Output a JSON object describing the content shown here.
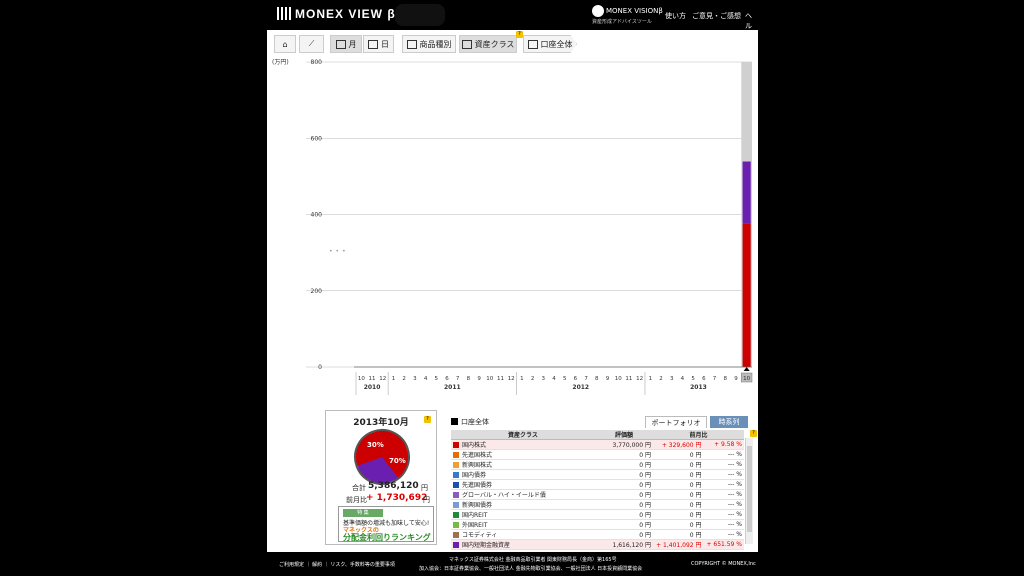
{
  "header": {
    "logo_text": "MONEX VIEW β",
    "vision_title": "MONEX VISIONβ",
    "vision_sub": "資産形成アドバイスツール",
    "links": [
      "使い方",
      "ご意見・ご感想",
      "ヘル"
    ]
  },
  "toolbar": {
    "month_label": "月",
    "day_label": "日",
    "product_label": "商品種別",
    "asset_class_label": "資産クラス",
    "account_label": "口座全体",
    "help_mark": "?"
  },
  "chart_data": {
    "type": "bar",
    "unit_label": "(万円)",
    "ylim": [
      0,
      800
    ],
    "yticks": [
      "0",
      "200",
      "400",
      "600",
      "800"
    ],
    "months": [
      "10",
      "11",
      "12",
      "1",
      "2",
      "3",
      "4",
      "5",
      "6",
      "7",
      "8",
      "9",
      "10",
      "11",
      "12",
      "1",
      "2",
      "3",
      "4",
      "5",
      "6",
      "7",
      "8",
      "9",
      "10",
      "11",
      "12",
      "1",
      "2",
      "3",
      "4",
      "5",
      "6",
      "7",
      "8",
      "9",
      "10"
    ],
    "year_labels": [
      {
        "label": "2010",
        "start": 0,
        "end": 2
      },
      {
        "label": "2011",
        "start": 3,
        "end": 14
      },
      {
        "label": "2012",
        "start": 15,
        "end": 26
      },
      {
        "label": "2013",
        "start": 27,
        "end": 36
      }
    ],
    "series": [
      {
        "name": "国内株式",
        "color": "#cc0000",
        "values": [
          0,
          0,
          0,
          0,
          0,
          0,
          0,
          0,
          0,
          0,
          0,
          0,
          0,
          0,
          0,
          0,
          0,
          0,
          0,
          0,
          0,
          0,
          0,
          0,
          0,
          0,
          0,
          0,
          0,
          0,
          0,
          0,
          0,
          0,
          0,
          0,
          377
        ]
      },
      {
        "name": "国内短期金融資産",
        "color": "#6a1fb0",
        "values": [
          0,
          0,
          0,
          0,
          0,
          0,
          0,
          0,
          0,
          0,
          0,
          0,
          0,
          0,
          0,
          0,
          0,
          0,
          0,
          0,
          0,
          0,
          0,
          0,
          0,
          0,
          0,
          0,
          0,
          0,
          0,
          0,
          0,
          0,
          0,
          0,
          162
        ]
      }
    ],
    "selected_index": 36
  },
  "portfolio": {
    "date_label": "2013年10月",
    "pie_pct_1": "30%",
    "pie_pct_2": "70%",
    "total_label": "合計",
    "total_value": "5,386,120",
    "yen": "円",
    "prev_label": "前月比",
    "prev_value": "+ 1,730,692",
    "promo_tag": "特 集",
    "promo_line1": "基準価額の増減も加味して安心!",
    "promo_line2": "マネックスの",
    "promo_line3": "分配金利回りランキング",
    "account_scope": "口座全体",
    "tab_portfolio": "ポートフォリオ",
    "tab_timeseries": "時系列",
    "columns": [
      "資産クラス",
      "評価額",
      "前月比"
    ],
    "rows": [
      {
        "color": "#cc0000",
        "name": "国内株式",
        "value": "3,770,000",
        "yen": "円",
        "chg": "+ 329,600",
        "chg_yen": "円",
        "pct": "+ 9.58",
        "pctsign": "%"
      },
      {
        "color": "#e46c0a",
        "name": "先進国株式",
        "value": "0",
        "yen": "円",
        "chg": "0",
        "chg_yen": "円",
        "pct": "---",
        "pctsign": "%"
      },
      {
        "color": "#f0a030",
        "name": "新興国株式",
        "value": "0",
        "yen": "円",
        "chg": "0",
        "chg_yen": "円",
        "pct": "---",
        "pctsign": "%"
      },
      {
        "color": "#3a78c8",
        "name": "国内債券",
        "value": "0",
        "yen": "円",
        "chg": "0",
        "chg_yen": "円",
        "pct": "---",
        "pctsign": "%"
      },
      {
        "color": "#1a4fb0",
        "name": "先進国債券",
        "value": "0",
        "yen": "円",
        "chg": "0",
        "chg_yen": "円",
        "pct": "---",
        "pctsign": "%"
      },
      {
        "color": "#8a5cc0",
        "name": "グローバル・ハイ・イールド債",
        "value": "0",
        "yen": "円",
        "chg": "0",
        "chg_yen": "円",
        "pct": "---",
        "pctsign": "%"
      },
      {
        "color": "#7a9ad8",
        "name": "新興国債券",
        "value": "0",
        "yen": "円",
        "chg": "0",
        "chg_yen": "円",
        "pct": "---",
        "pctsign": "%"
      },
      {
        "color": "#1e8a3a",
        "name": "国内REIT",
        "value": "0",
        "yen": "円",
        "chg": "0",
        "chg_yen": "円",
        "pct": "---",
        "pctsign": "%"
      },
      {
        "color": "#7ab84a",
        "name": "外国REIT",
        "value": "0",
        "yen": "円",
        "chg": "0",
        "chg_yen": "円",
        "pct": "---",
        "pctsign": "%"
      },
      {
        "color": "#a07050",
        "name": "コモディティ",
        "value": "0",
        "yen": "円",
        "chg": "0",
        "chg_yen": "円",
        "pct": "---",
        "pctsign": "%"
      },
      {
        "color": "#6a1fb0",
        "name": "国内短期金融資産",
        "value": "1,616,120",
        "yen": "円",
        "chg": "+ 1,401,092",
        "chg_yen": "円",
        "pct": "+ 651.59",
        "pctsign": "%"
      }
    ]
  },
  "footer": {
    "left": "ご利用規定 ｜ 解約 ｜ リスク、手数料等の重要事項",
    "center1": "マネックス証券株式会社 金融商品取引業者 関東財務局長（金商）第165号",
    "center2": "加入協会：日本証券業協会、一般社団法人 金融先物取引業協会、一般社団法人 日本投資顧問業協会",
    "right": "COPYRIGHT © MONEX,Inc"
  }
}
